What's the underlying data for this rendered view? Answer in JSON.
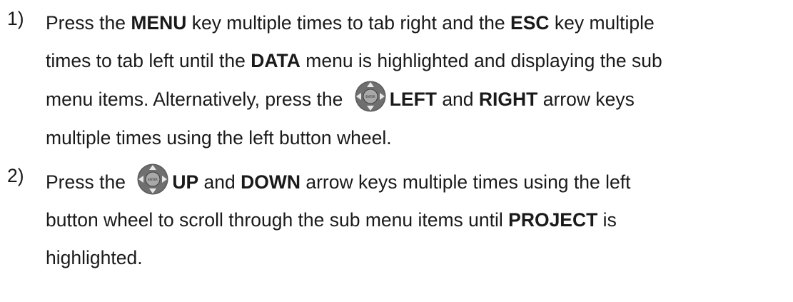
{
  "steps": [
    {
      "number": "1)",
      "lines": [
        {
          "t1": "Press the ",
          "b1": "MENU",
          "t2": " key multiple times to tab right and the ",
          "b2": "ESC",
          "t3": " key multiple"
        },
        {
          "t1": "times to tab left until the ",
          "b1": "DATA",
          "t2": " menu is highlighted and displaying the sub"
        },
        {
          "t1": "menu items.  Alternatively, press the ",
          "icon": "directional-wheel-icon",
          "b1": "LEFT",
          "t2": " and ",
          "b2": "RIGHT",
          "t3": " arrow keys"
        },
        {
          "t1": "multiple times using the left button wheel."
        }
      ]
    },
    {
      "number": "2)",
      "lines": [
        {
          "t1": "Press the ",
          "icon": "directional-wheel-icon",
          "b1": "UP",
          "t2": " and ",
          "b2": "DOWN",
          "t3": " arrow keys multiple times using the left"
        },
        {
          "t1": "button wheel to scroll through the sub menu items until ",
          "b1": "PROJECT",
          "t2": " is"
        },
        {
          "t1": "highlighted."
        }
      ]
    }
  ],
  "wheel": {
    "center_label": "ENTER",
    "ring_color": "#5a5a5a",
    "center_color": "#8c8c8c"
  }
}
